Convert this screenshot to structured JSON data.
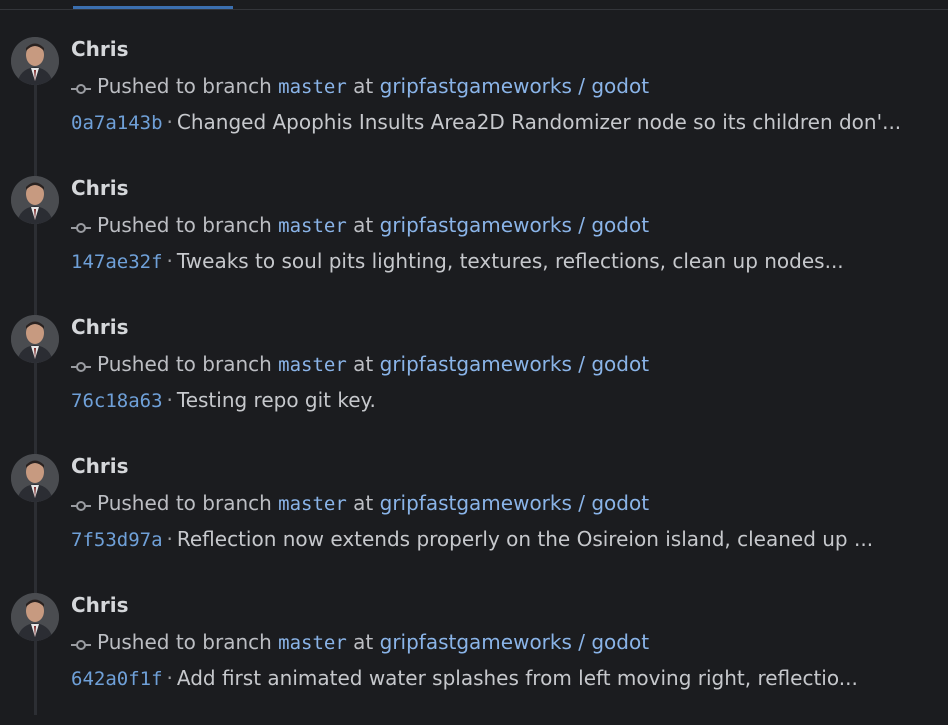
{
  "feed": {
    "entries": [
      {
        "author": "Chris",
        "action_prefix": "Pushed to branch",
        "branch": "master",
        "at_label": "at",
        "repo": "gripfastgameworks / godot",
        "sha": "0a7a143b",
        "message": "Changed Apophis Insults Area2D Randomizer node so its children don'..."
      },
      {
        "author": "Chris",
        "action_prefix": "Pushed to branch",
        "branch": "master",
        "at_label": "at",
        "repo": "gripfastgameworks / godot",
        "sha": "147ae32f",
        "message": "Tweaks to soul pits lighting, textures, reflections, clean up nodes..."
      },
      {
        "author": "Chris",
        "action_prefix": "Pushed to branch",
        "branch": "master",
        "at_label": "at",
        "repo": "gripfastgameworks / godot",
        "sha": "76c18a63",
        "message": "Testing repo git key."
      },
      {
        "author": "Chris",
        "action_prefix": "Pushed to branch",
        "branch": "master",
        "at_label": "at",
        "repo": "gripfastgameworks / godot",
        "sha": "7f53d97a",
        "message": "Reflection now extends properly on the Osireion island, cleaned up ..."
      },
      {
        "author": "Chris",
        "action_prefix": "Pushed to branch",
        "branch": "master",
        "at_label": "at",
        "repo": "gripfastgameworks / godot",
        "sha": "642a0f1f",
        "message": "Add first animated water splashes from left moving right, reflectio..."
      }
    ],
    "separator": "·"
  },
  "colors": {
    "background": "#1b1c1f",
    "link": "#8ab4e8",
    "sha": "#6fa0d8",
    "active_tab": "#3b6fb0"
  }
}
